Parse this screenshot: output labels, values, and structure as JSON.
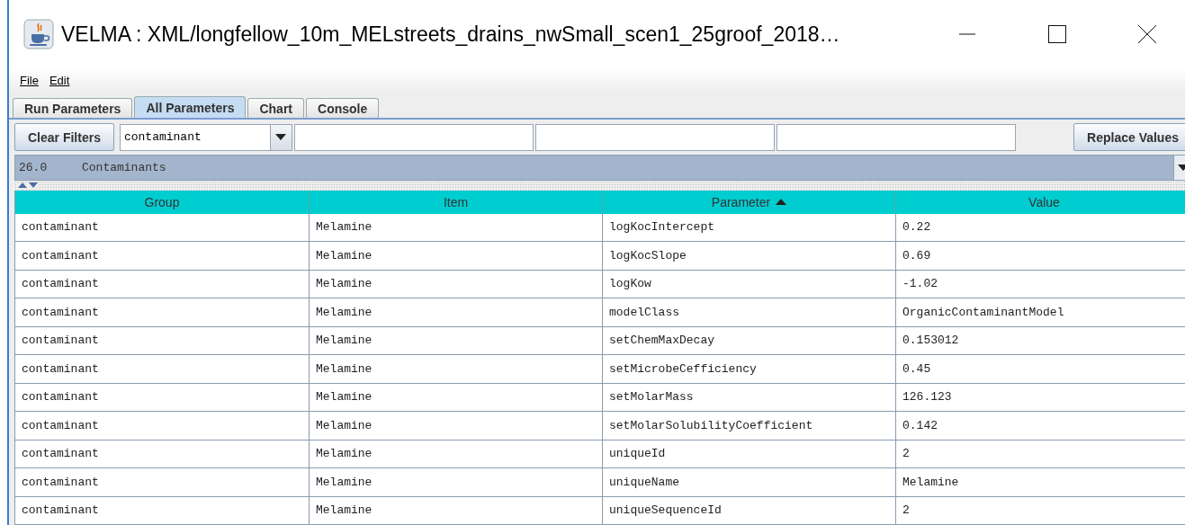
{
  "window": {
    "title": "VELMA : XML/longfellow_10m_MELstreets_drains_nwSmall_scen1_25groof_2018…"
  },
  "menu": [
    "File",
    "Edit"
  ],
  "tabs": [
    {
      "label": "Run Parameters",
      "selected": false
    },
    {
      "label": "All Parameters",
      "selected": true
    },
    {
      "label": "Chart",
      "selected": false
    },
    {
      "label": "Console",
      "selected": false
    }
  ],
  "toolbar": {
    "clear_button": "Clear Filters",
    "filter_combo": {
      "value": "contaminant"
    },
    "replace_button": "Replace Values"
  },
  "section": {
    "number": "26.0",
    "name": "Contaminants"
  },
  "table": {
    "columns": [
      {
        "label": "Group",
        "sorted": false
      },
      {
        "label": "Item",
        "sorted": false
      },
      {
        "label": "Parameter",
        "sorted": true
      },
      {
        "label": "Value",
        "sorted": false
      }
    ],
    "rows": [
      [
        "contaminant",
        "Melamine",
        "logKocIntercept",
        "0.22"
      ],
      [
        "contaminant",
        "Melamine",
        "logKocSlope",
        "0.69"
      ],
      [
        "contaminant",
        "Melamine",
        "logKow",
        "-1.02"
      ],
      [
        "contaminant",
        "Melamine",
        "modelClass",
        "OrganicContaminantModel"
      ],
      [
        "contaminant",
        "Melamine",
        "setChemMaxDecay",
        "0.153012"
      ],
      [
        "contaminant",
        "Melamine",
        "setMicrobeCefficiency",
        "0.45"
      ],
      [
        "contaminant",
        "Melamine",
        "setMolarMass",
        "126.123"
      ],
      [
        "contaminant",
        "Melamine",
        "setMolarSolubilityCoefficient",
        "0.142"
      ],
      [
        "contaminant",
        "Melamine",
        "uniqueId",
        "2"
      ],
      [
        "contaminant",
        "Melamine",
        "uniqueName",
        "Melamine"
      ],
      [
        "contaminant",
        "Melamine",
        "uniqueSequenceId",
        "2"
      ]
    ]
  }
}
